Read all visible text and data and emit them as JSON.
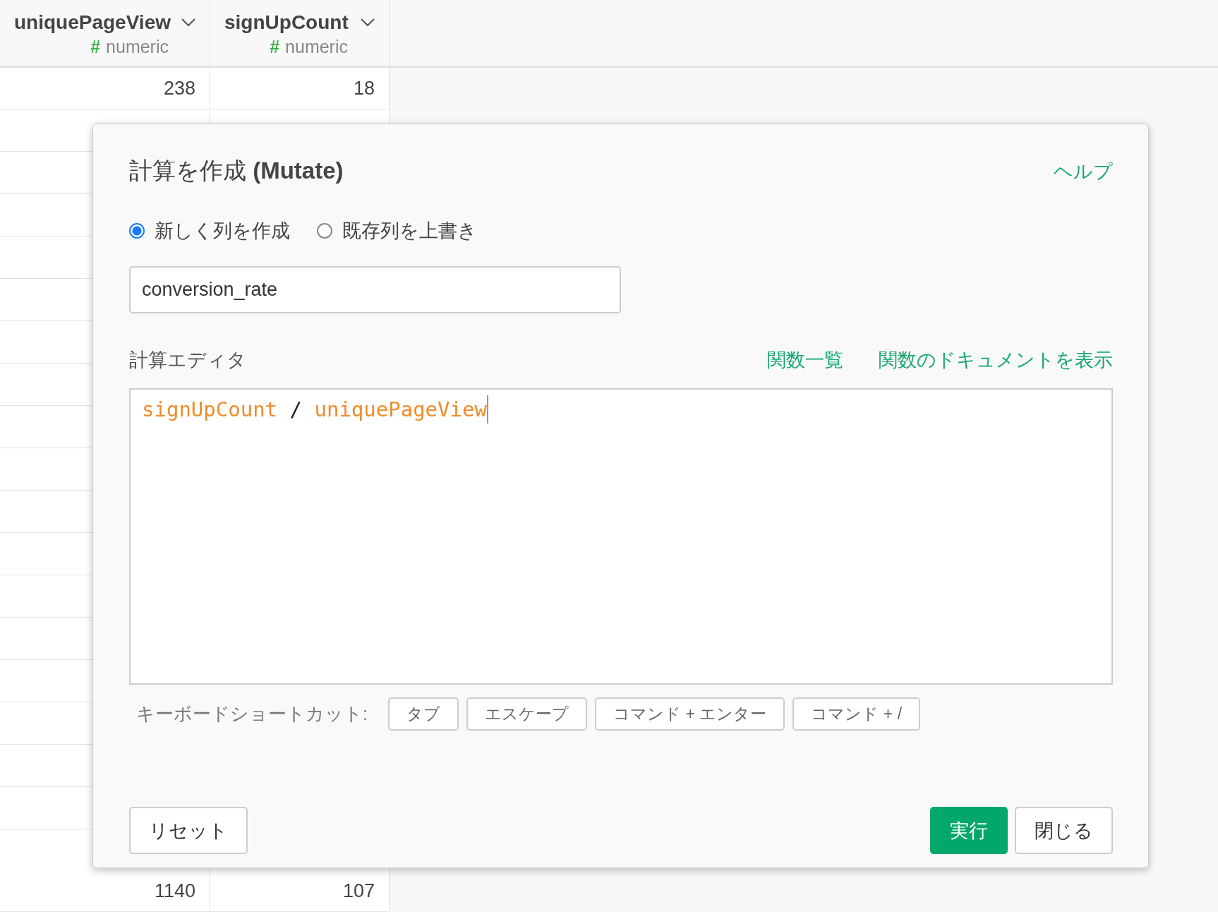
{
  "table": {
    "columns": [
      {
        "name": "uniquePageView",
        "type_icon": "#",
        "type": "numeric"
      },
      {
        "name": "signUpCount",
        "type_icon": "#",
        "type": "numeric"
      }
    ],
    "top_rows": [
      [
        "238",
        "18"
      ]
    ],
    "bottom_rows": [
      [
        "1140",
        "107"
      ]
    ]
  },
  "dialog": {
    "title": "計算を作成 **(Mutate)**",
    "help_link": "ヘルプ",
    "mode_options": [
      {
        "label": "新しく列を作成",
        "selected": true
      },
      {
        "label": "既存列を上書き",
        "selected": false
      }
    ],
    "column_name": {
      "value": "conversion_rate"
    },
    "editor_label": "計算エディタ",
    "editor_links": [
      "関数一覧",
      "関数のドキュメントを表示"
    ],
    "code_tokens": [
      {
        "kind": "column",
        "text": "signUpCount"
      },
      {
        "kind": "operator",
        "text": "/"
      },
      {
        "kind": "column",
        "text": "uniquePageView"
      }
    ],
    "shortcuts_label": "キーボードショートカット:",
    "shortcut_keys": [
      "タブ",
      "エスケープ",
      "コマンド + エンター",
      "コマンド + /"
    ],
    "buttons": [
      {
        "label": "リセット",
        "kind": "secondary"
      },
      {
        "label": "実行",
        "kind": "primary"
      },
      {
        "label": "閉じる",
        "kind": "secondary"
      }
    ]
  }
}
